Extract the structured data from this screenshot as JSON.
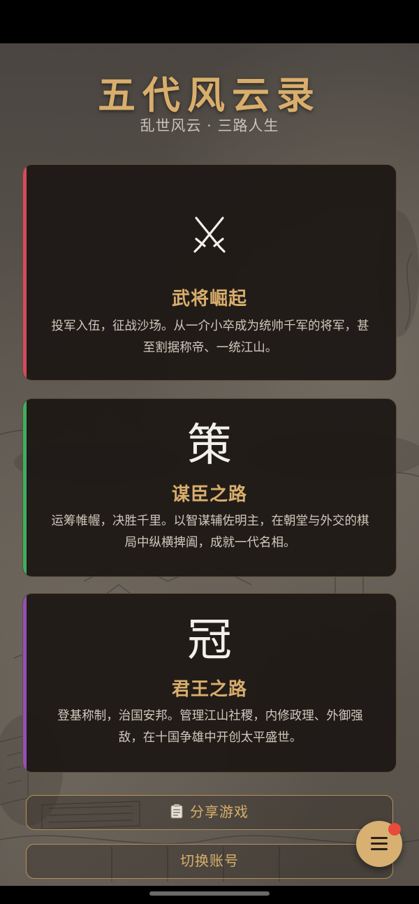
{
  "app": {
    "title": "五代风云录",
    "subtitle": "乱世风云 · 三路人生"
  },
  "paths": [
    {
      "icon": "crossed-swords-icon",
      "title": "武将崛起",
      "description": "投军入伍，征战沙场。从一介小卒成为统帅千军的将军，甚至割据称帝、一统江山。",
      "accent_color": "#d44b5e"
    },
    {
      "icon_text": "策",
      "title": "谋臣之路",
      "description": "运筹帷幄，决胜千里。以智谋辅佐明主，在朝堂与外交的棋局中纵横捭阖，成就一代名相。",
      "accent_color": "#3fae5f"
    },
    {
      "icon_text": "冠",
      "title": "君王之路",
      "description": "登基称制，治国安邦。管理江山社稷，内修政理、外御强敌，在十国争雄中开创太平盛世。",
      "accent_color": "#9350b8"
    }
  ],
  "actions": {
    "share_icon": "clipboard-icon",
    "share_label": "分享游戏",
    "switch_account_label": "切换账号"
  },
  "fab": {
    "icon": "menu-icon",
    "has_notification": true,
    "color": "#d8b072",
    "notification_color": "#e84a3c"
  },
  "theme": {
    "gold": "#d9ae6c",
    "card_bg": "#1e1916"
  }
}
